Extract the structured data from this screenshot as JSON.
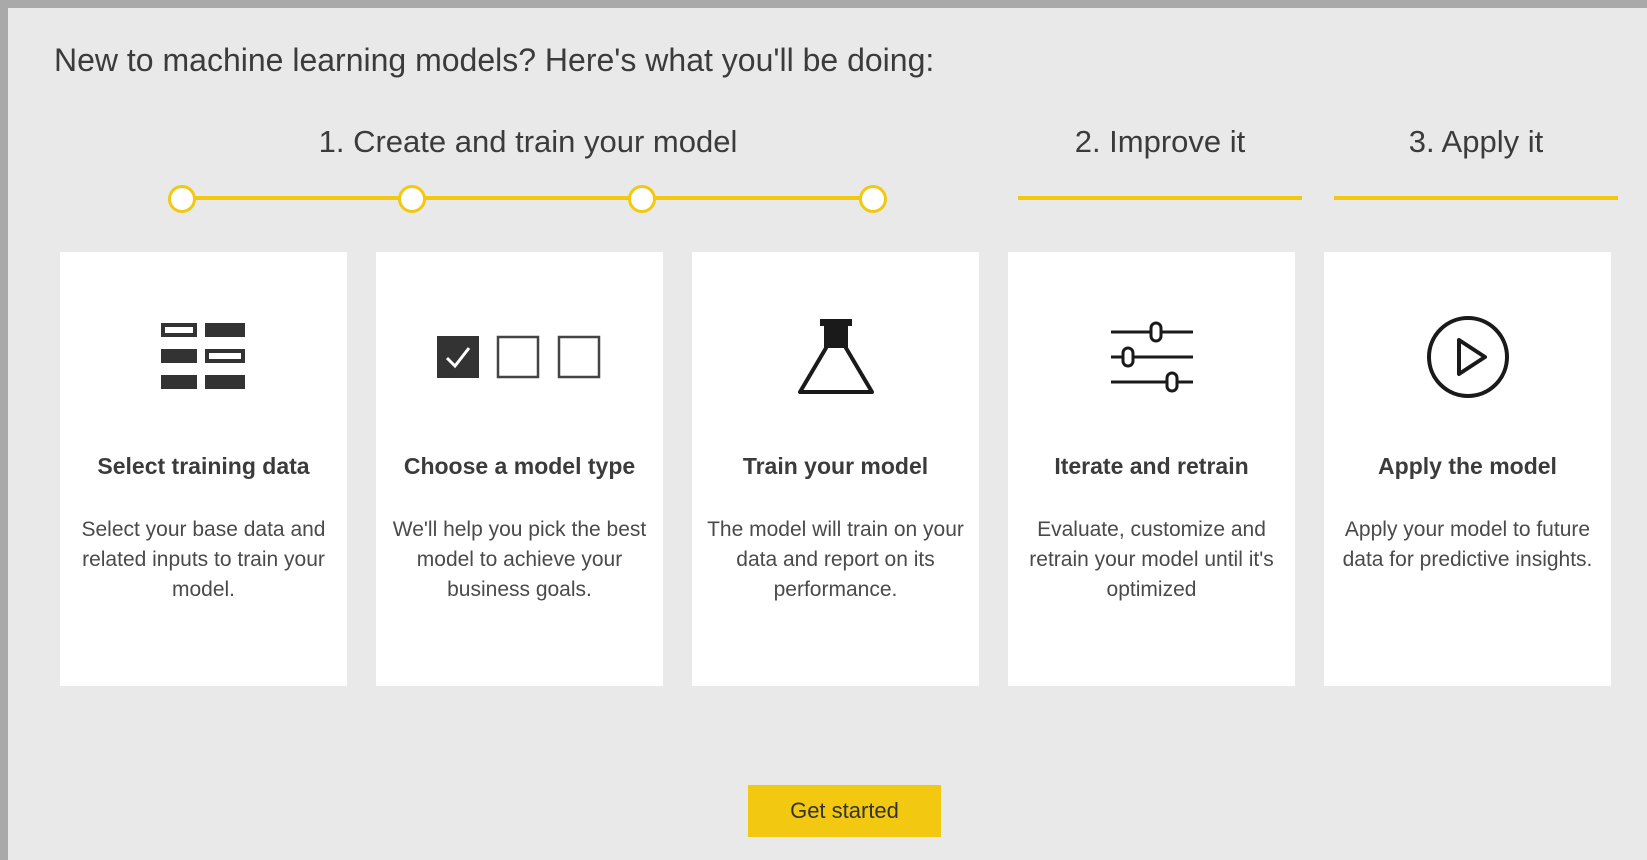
{
  "intro": "New to machine learning models? Here's what you'll be doing:",
  "phases": [
    {
      "title": "1. Create and train your model"
    },
    {
      "title": "2. Improve it"
    },
    {
      "title": "3. Apply it"
    }
  ],
  "accent_color": "#f2c811",
  "steps": [
    {
      "icon": "table-rows-icon",
      "title": "Select training data",
      "desc": "Select your base data and related inputs to train your model."
    },
    {
      "icon": "checkbox-options-icon",
      "title": "Choose a model type",
      "desc": "We'll help you pick the best model to achieve your business goals."
    },
    {
      "icon": "flask-icon",
      "title": "Train your model",
      "desc": "The model will train on your data and report on its performance."
    },
    {
      "icon": "sliders-icon",
      "title": "Iterate and retrain",
      "desc": "Evaluate, customize and retrain your model until it's optimized"
    },
    {
      "icon": "play-circle-icon",
      "title": "Apply the model",
      "desc": "Apply your model to future data for predictive insights."
    }
  ],
  "cta": {
    "label": "Get started"
  }
}
